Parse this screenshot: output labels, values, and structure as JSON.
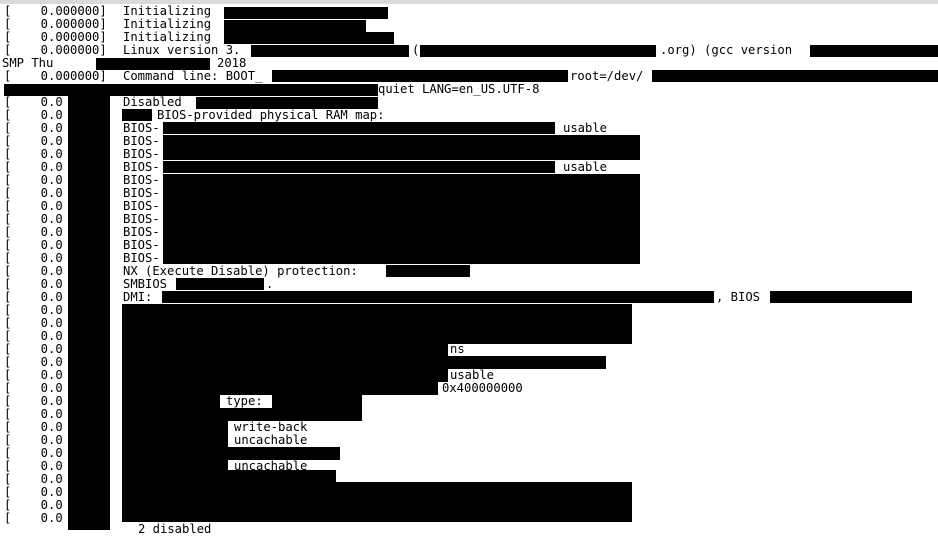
{
  "ts_full": "[    0.000000]",
  "ts_short": "[    0.0",
  "lines": {
    "l1": "Initializing",
    "l2": "Initializing",
    "l3": "Initializing",
    "l4_a": "Linux version 3.",
    "l4_b": "(",
    "l4_c": ".org) (gcc version",
    "l5_a": "SMP Thu",
    "l5_b": "2018",
    "l6_a": "Command line: BOOT_",
    "l6_b": "root=/dev/",
    "l7": "quiet LANG=en_US.UTF-8",
    "l8": "Disabled",
    "l9": "BIOS-provided physical RAM map:",
    "bios": "BIOS-",
    "usable": "usable",
    "nx": "NX (Execute Disable) protection:",
    "smbios": "SMBIOS",
    "dot": ".",
    "dmi": "DMI:",
    "dmi_b": ", BIOS",
    "ns": "ns",
    "hex": "0x400000000",
    "type": "type:",
    "writeback": "write-back",
    "uncachable": "uncachable",
    "disabled": "2 disabled"
  }
}
